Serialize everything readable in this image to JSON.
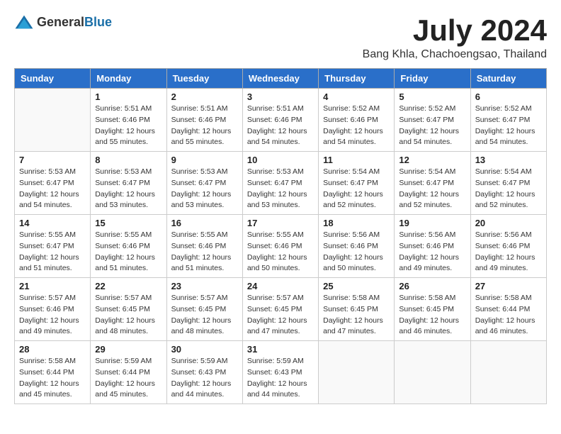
{
  "logo": {
    "general": "General",
    "blue": "Blue"
  },
  "title": "July 2024",
  "location": "Bang Khla, Chachoengsao, Thailand",
  "weekdays": [
    "Sunday",
    "Monday",
    "Tuesday",
    "Wednesday",
    "Thursday",
    "Friday",
    "Saturday"
  ],
  "weeks": [
    [
      {
        "day": "",
        "sunrise": "",
        "sunset": "",
        "daylight": ""
      },
      {
        "day": "1",
        "sunrise": "Sunrise: 5:51 AM",
        "sunset": "Sunset: 6:46 PM",
        "daylight": "Daylight: 12 hours and 55 minutes."
      },
      {
        "day": "2",
        "sunrise": "Sunrise: 5:51 AM",
        "sunset": "Sunset: 6:46 PM",
        "daylight": "Daylight: 12 hours and 55 minutes."
      },
      {
        "day": "3",
        "sunrise": "Sunrise: 5:51 AM",
        "sunset": "Sunset: 6:46 PM",
        "daylight": "Daylight: 12 hours and 54 minutes."
      },
      {
        "day": "4",
        "sunrise": "Sunrise: 5:52 AM",
        "sunset": "Sunset: 6:46 PM",
        "daylight": "Daylight: 12 hours and 54 minutes."
      },
      {
        "day": "5",
        "sunrise": "Sunrise: 5:52 AM",
        "sunset": "Sunset: 6:47 PM",
        "daylight": "Daylight: 12 hours and 54 minutes."
      },
      {
        "day": "6",
        "sunrise": "Sunrise: 5:52 AM",
        "sunset": "Sunset: 6:47 PM",
        "daylight": "Daylight: 12 hours and 54 minutes."
      }
    ],
    [
      {
        "day": "7",
        "sunrise": "Sunrise: 5:53 AM",
        "sunset": "Sunset: 6:47 PM",
        "daylight": "Daylight: 12 hours and 54 minutes."
      },
      {
        "day": "8",
        "sunrise": "Sunrise: 5:53 AM",
        "sunset": "Sunset: 6:47 PM",
        "daylight": "Daylight: 12 hours and 53 minutes."
      },
      {
        "day": "9",
        "sunrise": "Sunrise: 5:53 AM",
        "sunset": "Sunset: 6:47 PM",
        "daylight": "Daylight: 12 hours and 53 minutes."
      },
      {
        "day": "10",
        "sunrise": "Sunrise: 5:53 AM",
        "sunset": "Sunset: 6:47 PM",
        "daylight": "Daylight: 12 hours and 53 minutes."
      },
      {
        "day": "11",
        "sunrise": "Sunrise: 5:54 AM",
        "sunset": "Sunset: 6:47 PM",
        "daylight": "Daylight: 12 hours and 52 minutes."
      },
      {
        "day": "12",
        "sunrise": "Sunrise: 5:54 AM",
        "sunset": "Sunset: 6:47 PM",
        "daylight": "Daylight: 12 hours and 52 minutes."
      },
      {
        "day": "13",
        "sunrise": "Sunrise: 5:54 AM",
        "sunset": "Sunset: 6:47 PM",
        "daylight": "Daylight: 12 hours and 52 minutes."
      }
    ],
    [
      {
        "day": "14",
        "sunrise": "Sunrise: 5:55 AM",
        "sunset": "Sunset: 6:47 PM",
        "daylight": "Daylight: 12 hours and 51 minutes."
      },
      {
        "day": "15",
        "sunrise": "Sunrise: 5:55 AM",
        "sunset": "Sunset: 6:46 PM",
        "daylight": "Daylight: 12 hours and 51 minutes."
      },
      {
        "day": "16",
        "sunrise": "Sunrise: 5:55 AM",
        "sunset": "Sunset: 6:46 PM",
        "daylight": "Daylight: 12 hours and 51 minutes."
      },
      {
        "day": "17",
        "sunrise": "Sunrise: 5:55 AM",
        "sunset": "Sunset: 6:46 PM",
        "daylight": "Daylight: 12 hours and 50 minutes."
      },
      {
        "day": "18",
        "sunrise": "Sunrise: 5:56 AM",
        "sunset": "Sunset: 6:46 PM",
        "daylight": "Daylight: 12 hours and 50 minutes."
      },
      {
        "day": "19",
        "sunrise": "Sunrise: 5:56 AM",
        "sunset": "Sunset: 6:46 PM",
        "daylight": "Daylight: 12 hours and 49 minutes."
      },
      {
        "day": "20",
        "sunrise": "Sunrise: 5:56 AM",
        "sunset": "Sunset: 6:46 PM",
        "daylight": "Daylight: 12 hours and 49 minutes."
      }
    ],
    [
      {
        "day": "21",
        "sunrise": "Sunrise: 5:57 AM",
        "sunset": "Sunset: 6:46 PM",
        "daylight": "Daylight: 12 hours and 49 minutes."
      },
      {
        "day": "22",
        "sunrise": "Sunrise: 5:57 AM",
        "sunset": "Sunset: 6:45 PM",
        "daylight": "Daylight: 12 hours and 48 minutes."
      },
      {
        "day": "23",
        "sunrise": "Sunrise: 5:57 AM",
        "sunset": "Sunset: 6:45 PM",
        "daylight": "Daylight: 12 hours and 48 minutes."
      },
      {
        "day": "24",
        "sunrise": "Sunrise: 5:57 AM",
        "sunset": "Sunset: 6:45 PM",
        "daylight": "Daylight: 12 hours and 47 minutes."
      },
      {
        "day": "25",
        "sunrise": "Sunrise: 5:58 AM",
        "sunset": "Sunset: 6:45 PM",
        "daylight": "Daylight: 12 hours and 47 minutes."
      },
      {
        "day": "26",
        "sunrise": "Sunrise: 5:58 AM",
        "sunset": "Sunset: 6:45 PM",
        "daylight": "Daylight: 12 hours and 46 minutes."
      },
      {
        "day": "27",
        "sunrise": "Sunrise: 5:58 AM",
        "sunset": "Sunset: 6:44 PM",
        "daylight": "Daylight: 12 hours and 46 minutes."
      }
    ],
    [
      {
        "day": "28",
        "sunrise": "Sunrise: 5:58 AM",
        "sunset": "Sunset: 6:44 PM",
        "daylight": "Daylight: 12 hours and 45 minutes."
      },
      {
        "day": "29",
        "sunrise": "Sunrise: 5:59 AM",
        "sunset": "Sunset: 6:44 PM",
        "daylight": "Daylight: 12 hours and 45 minutes."
      },
      {
        "day": "30",
        "sunrise": "Sunrise: 5:59 AM",
        "sunset": "Sunset: 6:43 PM",
        "daylight": "Daylight: 12 hours and 44 minutes."
      },
      {
        "day": "31",
        "sunrise": "Sunrise: 5:59 AM",
        "sunset": "Sunset: 6:43 PM",
        "daylight": "Daylight: 12 hours and 44 minutes."
      },
      {
        "day": "",
        "sunrise": "",
        "sunset": "",
        "daylight": ""
      },
      {
        "day": "",
        "sunrise": "",
        "sunset": "",
        "daylight": ""
      },
      {
        "day": "",
        "sunrise": "",
        "sunset": "",
        "daylight": ""
      }
    ]
  ]
}
